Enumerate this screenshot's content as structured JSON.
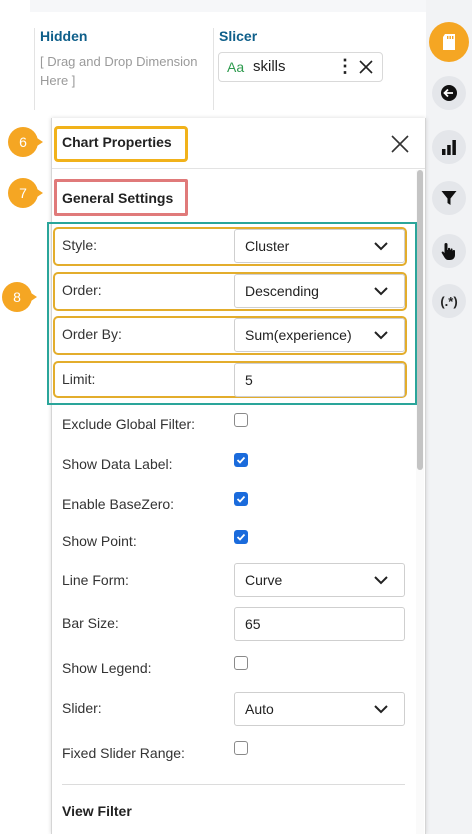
{
  "dropzones": {
    "hidden": {
      "title": "Hidden",
      "hint": "[ Drag and Drop Dimension Here ]"
    },
    "slicer": {
      "title": "Slicer",
      "chip": {
        "type_icon": "Aa",
        "name": "skills",
        "menu_icon": "kebab-menu-icon",
        "remove_icon": "close-icon"
      }
    }
  },
  "rightbar": {
    "items": [
      {
        "icon": "sd-card-icon",
        "active": true
      },
      {
        "icon": "back-arrow-icon"
      },
      {
        "icon": "bar-chart-icon"
      },
      {
        "icon": "filter-icon"
      },
      {
        "icon": "pointer-hand-icon"
      },
      {
        "icon": "regex-icon",
        "label": "(.*)"
      }
    ]
  },
  "panel": {
    "title": "Chart Properties",
    "close_icon": "close-icon",
    "general_settings": "General Settings",
    "fields": {
      "style": {
        "label": "Style:",
        "value": "Cluster"
      },
      "order": {
        "label": "Order:",
        "value": "Descending"
      },
      "order_by": {
        "label": "Order By:",
        "value": "Sum(experience)"
      },
      "limit": {
        "label": "Limit:",
        "value": "5"
      },
      "exclude_global_filter": {
        "label": "Exclude Global Filter:",
        "checked": false
      },
      "show_data_label": {
        "label": "Show Data Label:",
        "checked": true
      },
      "enable_basezero": {
        "label": "Enable BaseZero:",
        "checked": true
      },
      "show_point": {
        "label": "Show Point:",
        "checked": true
      },
      "line_form": {
        "label": "Line Form:",
        "value": "Curve"
      },
      "bar_size": {
        "label": "Bar Size:",
        "value": "65"
      },
      "show_legend": {
        "label": "Show Legend:",
        "checked": false
      },
      "slider": {
        "label": "Slider:",
        "value": "Auto"
      },
      "fixed_slider_range": {
        "label": "Fixed Slider Range:",
        "checked": false
      }
    },
    "view_filter": "View Filter"
  },
  "callouts": [
    "6",
    "7",
    "8"
  ],
  "colors": {
    "accent": "#f5a623",
    "highlight_orange": "#f1b21a",
    "highlight_red": "#e07a7a",
    "highlight_teal": "#2aa59a",
    "checkbox_blue": "#1a6bdc",
    "title_blue": "#0e5f8a"
  }
}
